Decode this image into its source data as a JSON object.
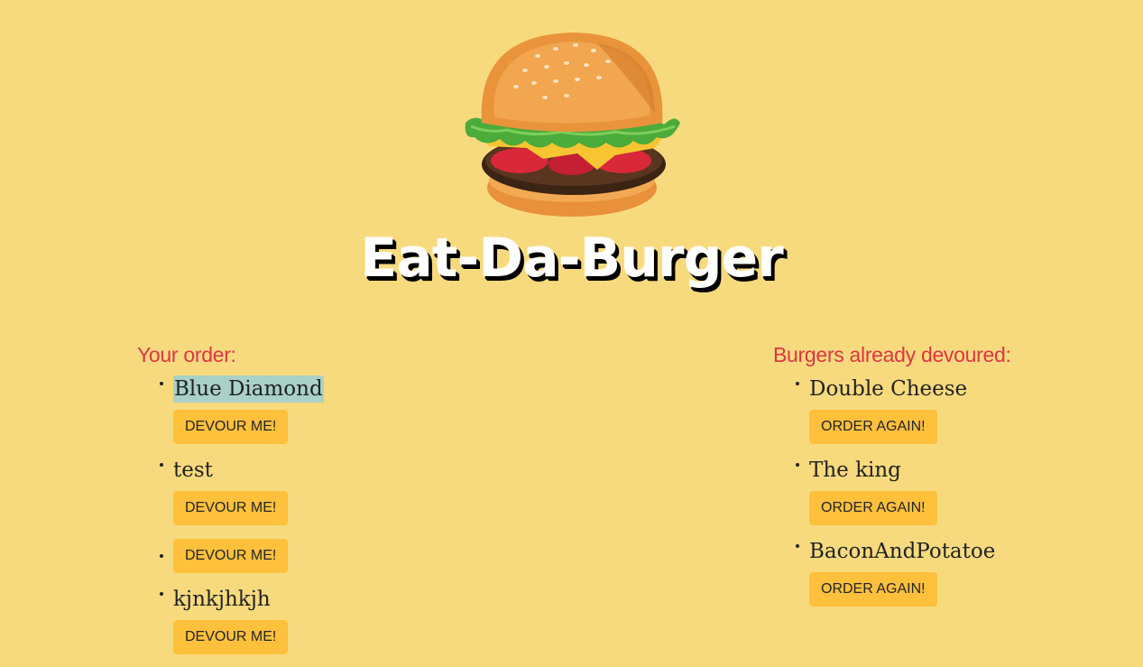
{
  "header": {
    "title": "Eat-Da-Burger",
    "logo_icon": "burger-icon"
  },
  "order": {
    "heading": "Your order:",
    "items": [
      {
        "name": "Blue Diamond",
        "button": "DEVOUR ME!",
        "highlighted": true
      },
      {
        "name": "test",
        "button": "DEVOUR ME!"
      },
      {
        "name": "",
        "button": "DEVOUR ME!"
      },
      {
        "name": "kjnkjhkjh",
        "button": "DEVOUR ME!"
      }
    ]
  },
  "devoured": {
    "heading": "Burgers already devoured:",
    "items": [
      {
        "name": "Double Cheese",
        "button": "ORDER AGAIN!"
      },
      {
        "name": "The king",
        "button": "ORDER AGAIN!"
      },
      {
        "name": "BaconAndPotatoe",
        "button": "ORDER AGAIN!"
      }
    ]
  },
  "colors": {
    "background": "#f8da7e",
    "heading": "#dc3545",
    "button": "#ffc03c",
    "highlight": "#a9d1c8"
  }
}
